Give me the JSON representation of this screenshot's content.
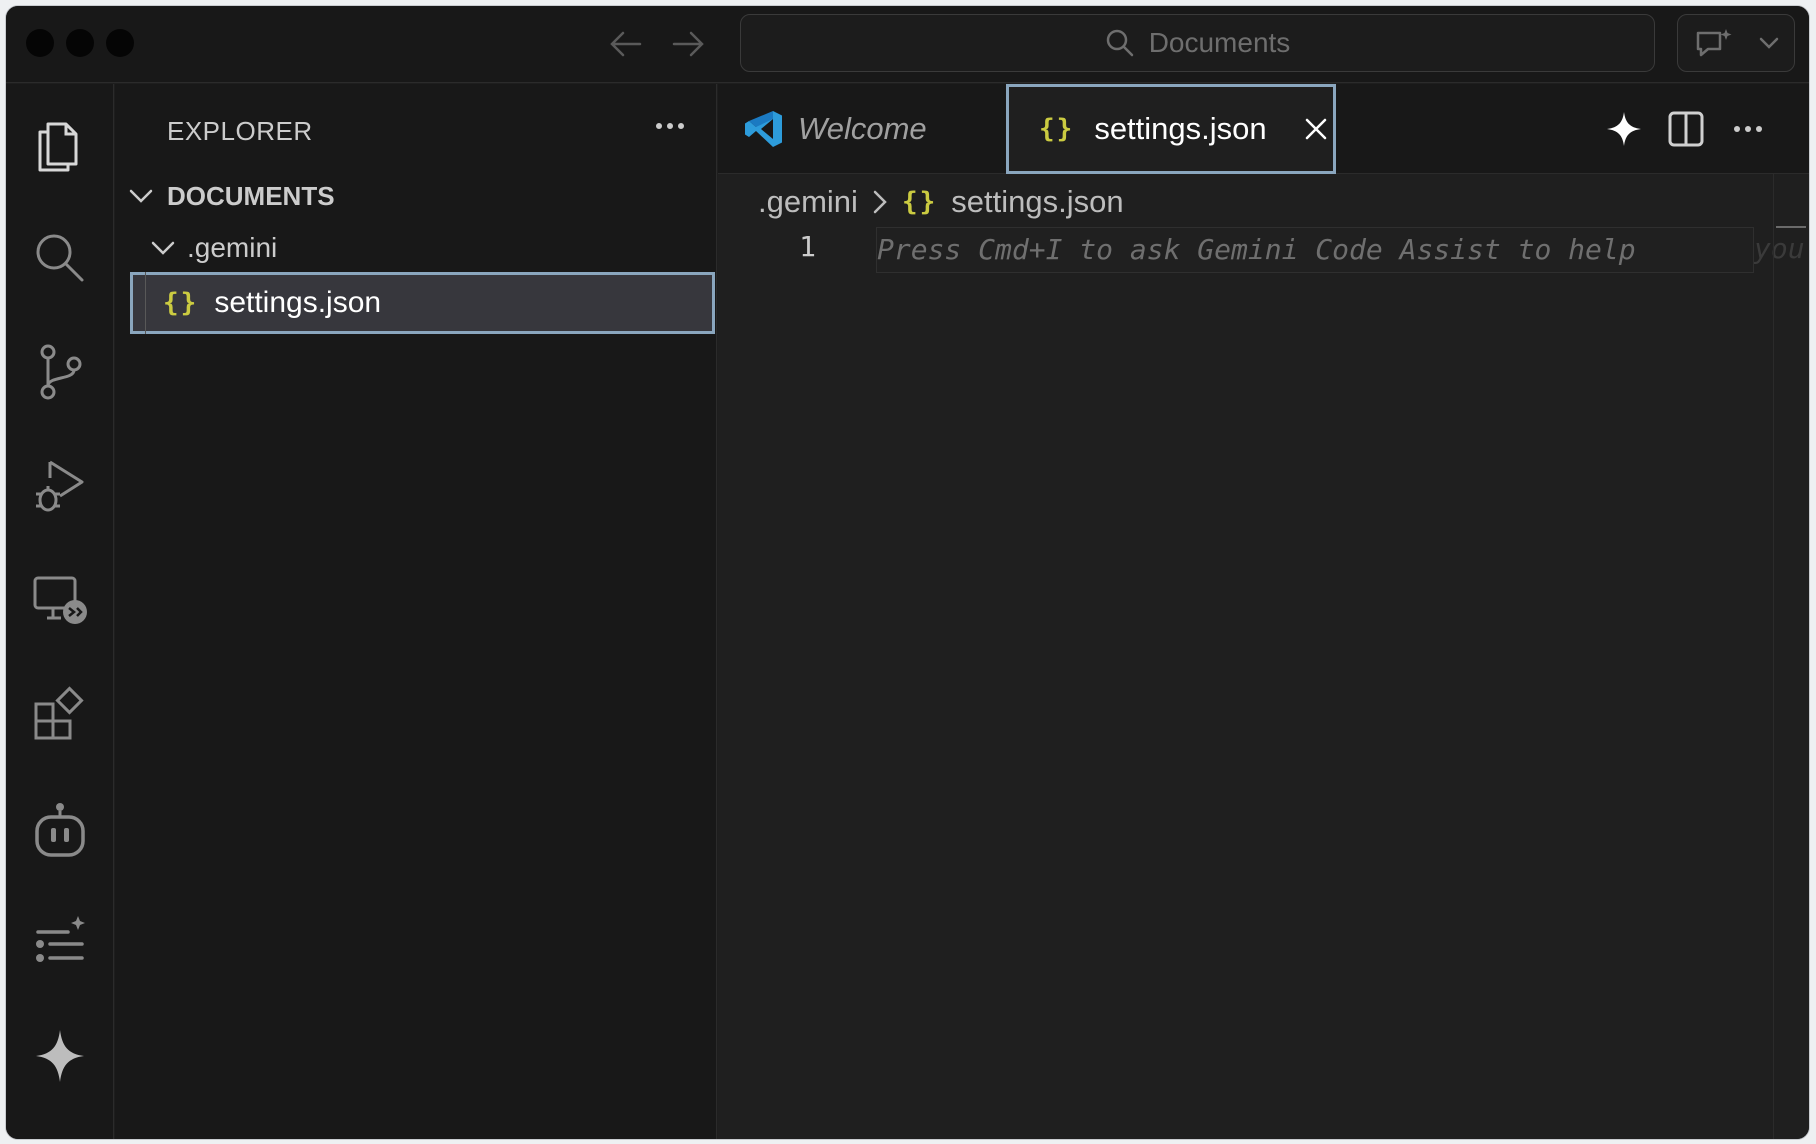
{
  "titlebar": {
    "search_text": "Documents"
  },
  "activity_bar": {
    "items": [
      "explorer",
      "search",
      "source-control",
      "run-and-debug",
      "remote-explorer",
      "extensions",
      "copilot-agent",
      "task-list",
      "gemini"
    ]
  },
  "sidebar": {
    "title": "EXPLORER",
    "tree": {
      "root": "DOCUMENTS",
      "folder": ".gemini",
      "file": "settings.json",
      "file_icon": "{}"
    }
  },
  "editor": {
    "tabs": [
      {
        "label": "Welcome",
        "active": false
      },
      {
        "label": "settings.json",
        "active": true,
        "icon": "{}"
      }
    ],
    "breadcrumb": {
      "folder": ".gemini",
      "file": "settings.json",
      "file_icon": "{}"
    },
    "line_number": "1",
    "ghost_text": "Press Cmd+I to ask Gemini Code Assist to help",
    "ghost_text_faded": "you co"
  },
  "colors": {
    "accent_border": "#8aa6be",
    "json_icon": "#cbcb41",
    "vscode_blue": "#2d9cdb"
  }
}
